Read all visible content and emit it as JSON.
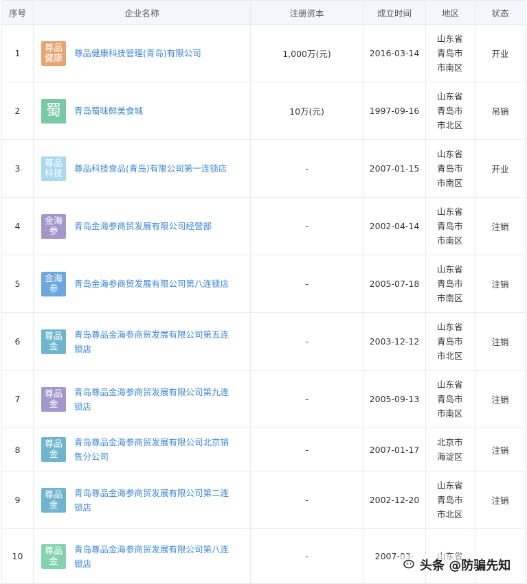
{
  "columns": {
    "index": "序号",
    "name": "企业名称",
    "capital": "注册资本",
    "founded": "成立时间",
    "region": "地区",
    "status": "状态"
  },
  "rows": [
    {
      "index": "1",
      "logo_text": "尊品健康",
      "logo_color": "#e8a472",
      "name": "尊品健康科技管理(青岛)有限公司",
      "capital": "1,000万(元)",
      "founded": "2016-03-14",
      "region": "山东省青岛市市南区",
      "status": "开业",
      "status_type": "open"
    },
    {
      "index": "2",
      "logo_text": "蜀",
      "logo_color": "#79c8a6",
      "name": "青岛蜀味鲜美食城",
      "capital": "10万(元)",
      "founded": "1997-09-16",
      "region": "山东省青岛市市北区",
      "status": "吊销",
      "status_type": "revoked"
    },
    {
      "index": "3",
      "logo_text": "尊品科技",
      "logo_color": "#a9d8f0",
      "name": "尊品科技食品(青岛)有限公司第一连锁店",
      "capital": "-",
      "founded": "2007-01-15",
      "region": "山东省青岛市市南区",
      "status": "开业",
      "status_type": "open"
    },
    {
      "index": "4",
      "logo_text": "金海参",
      "logo_color": "#a397cc",
      "name": "青岛金海参商贸发展有限公司经营部",
      "capital": "-",
      "founded": "2002-04-14",
      "region": "山东省青岛市市南区",
      "status": "注销",
      "status_type": "cancelled"
    },
    {
      "index": "5",
      "logo_text": "金海参",
      "logo_color": "#6ea7e0",
      "name": "青岛金海参商贸发展有限公司第八连锁店",
      "capital": "-",
      "founded": "2005-07-18",
      "region": "山东省青岛市市南区",
      "status": "注销",
      "status_type": "cancelled"
    },
    {
      "index": "6",
      "logo_text": "尊品金",
      "logo_color": "#6fb5cf",
      "name": "青岛尊品金海参商贸发展有限公司第五连锁店",
      "capital": "-",
      "founded": "2003-12-12",
      "region": "山东省青岛市市北区",
      "status": "注销",
      "status_type": "cancelled"
    },
    {
      "index": "7",
      "logo_text": "尊品金",
      "logo_color": "#a397cc",
      "name": "青岛尊品金海参商贸发展有限公司第九连锁店",
      "capital": "-",
      "founded": "2005-09-13",
      "region": "山东省青岛市市南区",
      "status": "注销",
      "status_type": "cancelled"
    },
    {
      "index": "8",
      "logo_text": "尊品金",
      "logo_color": "#6fb5cf",
      "name": "青岛尊品金海参商贸发展有限公司北京销售分公司",
      "capital": "-",
      "founded": "2007-01-17",
      "region": "北京市海淀区",
      "status": "注销",
      "status_type": "cancelled"
    },
    {
      "index": "9",
      "logo_text": "尊品金",
      "logo_color": "#6fb5cf",
      "name": "青岛尊品金海参商贸发展有限公司第二连锁店",
      "capital": "-",
      "founded": "2002-12-20",
      "region": "山东省青岛市市北区",
      "status": "注销",
      "status_type": "cancelled"
    },
    {
      "index": "10",
      "logo_text": "尊品金",
      "logo_color": "#86d1b0",
      "name": "青岛尊品金海参商贸发展有限公司第八连锁店",
      "capital": "-",
      "founded": "2007-03-",
      "region": "山东省",
      "status": "",
      "status_type": "cancelled"
    }
  ],
  "watermark": "头条 @防骗先知",
  "colors": {
    "link": "#3c86d6",
    "status_open": "#4caf50",
    "status_closed": "#e8584f",
    "header_bg": "#f3f6fa",
    "border": "#e4e9f0"
  }
}
